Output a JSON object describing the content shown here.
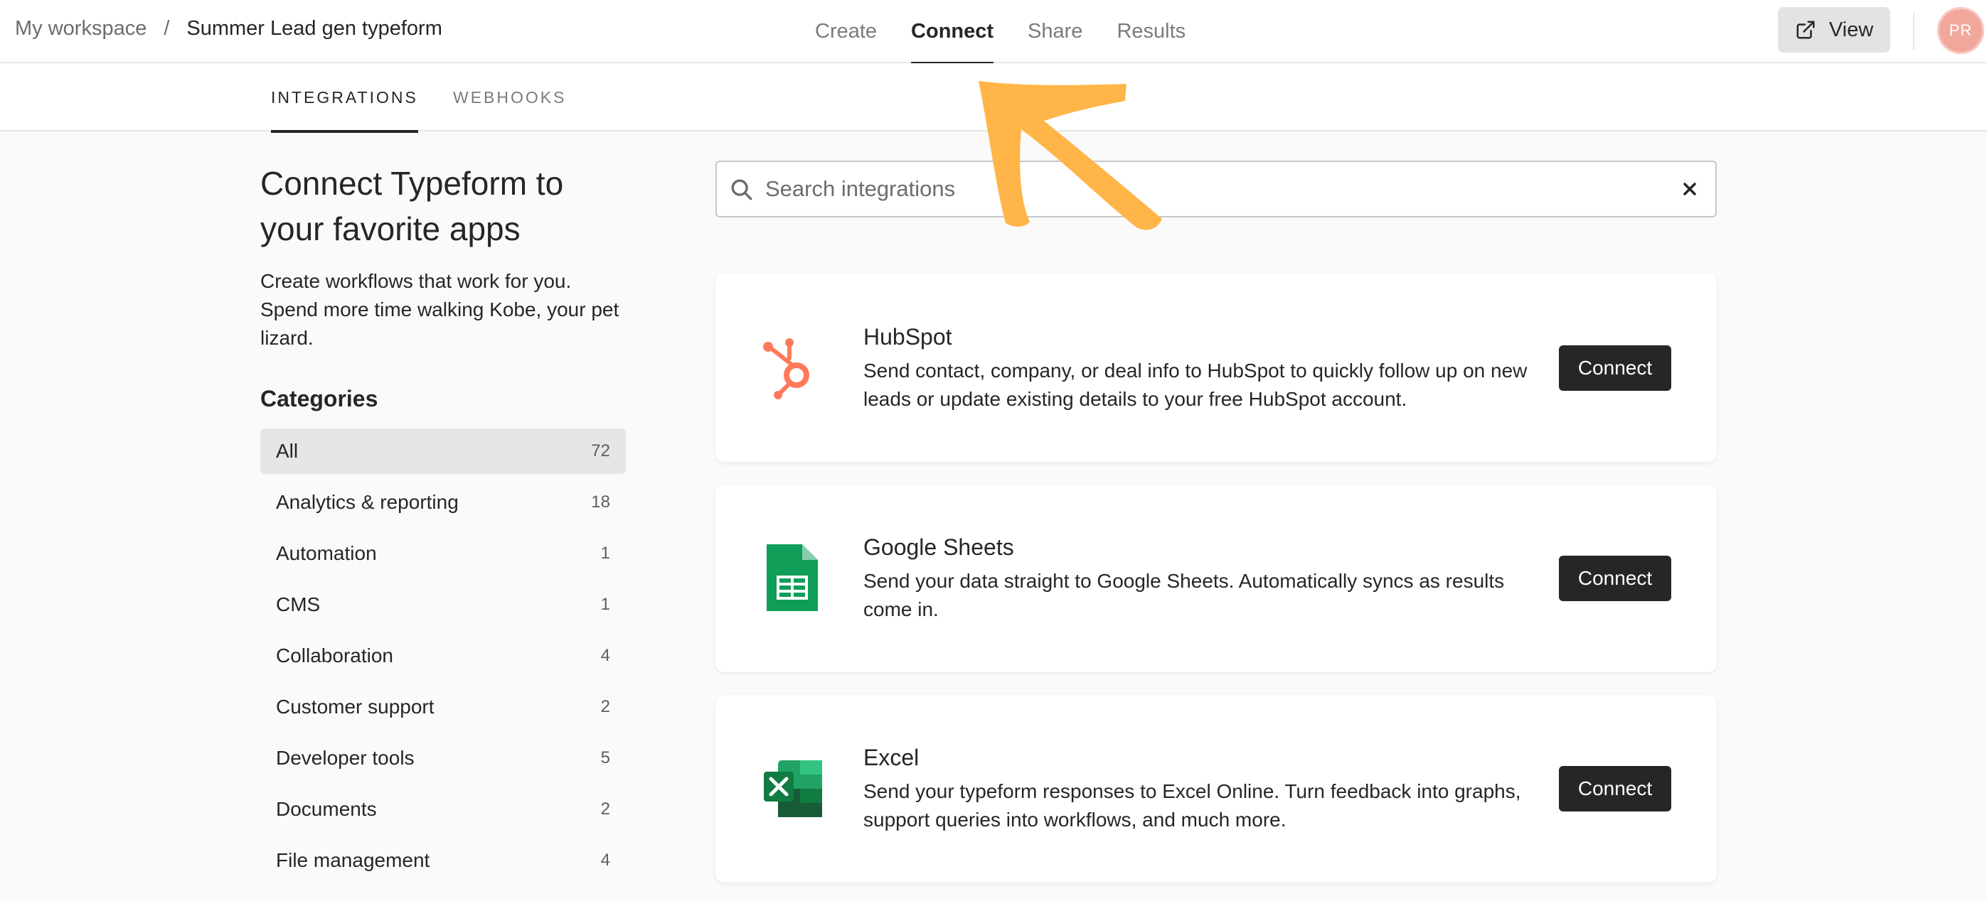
{
  "breadcrumb": {
    "workspace": "My workspace",
    "separator": "/",
    "form": "Summer Lead gen typeform"
  },
  "main_nav": {
    "tabs": [
      {
        "label": "Create"
      },
      {
        "label": "Connect"
      },
      {
        "label": "Share"
      },
      {
        "label": "Results"
      }
    ],
    "active": "Connect"
  },
  "header_actions": {
    "view_label": "View",
    "avatar_initials": "PR"
  },
  "sub_tabs": {
    "integrations": "INTEGRATIONS",
    "webhooks": "WEBHOOKS"
  },
  "intro": {
    "heading": "Connect Typeform to your favorite apps",
    "subtext": "Create workflows that work for you. Spend more time walking Kobe, your pet lizard."
  },
  "categories": {
    "title": "Categories",
    "items": [
      {
        "name": "All",
        "count": "72"
      },
      {
        "name": "Analytics & reporting",
        "count": "18"
      },
      {
        "name": "Automation",
        "count": "1"
      },
      {
        "name": "CMS",
        "count": "1"
      },
      {
        "name": "Collaboration",
        "count": "4"
      },
      {
        "name": "Customer support",
        "count": "2"
      },
      {
        "name": "Developer tools",
        "count": "5"
      },
      {
        "name": "Documents",
        "count": "2"
      },
      {
        "name": "File management",
        "count": "4"
      }
    ]
  },
  "search": {
    "placeholder": "Search integrations",
    "value": ""
  },
  "integrations": [
    {
      "name": "HubSpot",
      "description": "Send contact, company, or deal info to HubSpot to quickly follow up on new leads or update existing details to your free HubSpot account.",
      "button": "Connect",
      "icon": "hubspot-logo-icon"
    },
    {
      "name": "Google Sheets",
      "description": "Send your data straight to Google Sheets. Automatically syncs as results come in.",
      "button": "Connect",
      "icon": "google-sheets-logo-icon"
    },
    {
      "name": "Excel",
      "description": "Send your typeform responses to Excel Online. Turn feedback into graphs, support queries into workflows, and much more.",
      "button": "Connect",
      "icon": "excel-logo-icon"
    }
  ],
  "colors": {
    "accent_dark": "#262627",
    "annotation_arrow": "#FFB547",
    "hubspot": "#FF7A59",
    "sheets": "#0F9D58",
    "excel": "#107C41"
  }
}
